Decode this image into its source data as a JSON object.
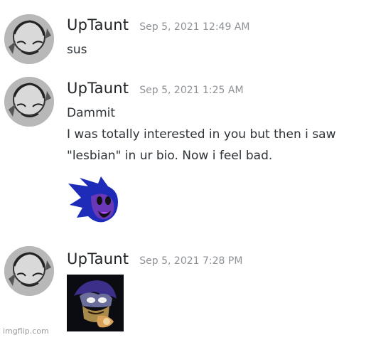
{
  "messages": [
    {
      "username": "UpTaunt",
      "timestamp": "Sep 5, 2021 12:49 AM",
      "lines": [
        "sus"
      ]
    },
    {
      "username": "UpTaunt",
      "timestamp": "Sep 5, 2021 1:25 AM",
      "lines": [
        "Dammit",
        "I was totally interested in you but then i saw",
        "\"lesbian\" in ur bio. Now i feel bad."
      ],
      "attachment": "custom-emoji-sonic-head"
    },
    {
      "username": "UpTaunt",
      "timestamp": "Sep 5, 2021 7:28 PM",
      "lines": [],
      "attachment": "image-attachment"
    }
  ],
  "watermark": "imgflip.com",
  "colors": {
    "text": "#2e3338",
    "username": "#1f2326",
    "timestamp": "#8e9297",
    "emoji_blue": "#1e2bb8",
    "emoji_purple": "#6a37b8"
  }
}
